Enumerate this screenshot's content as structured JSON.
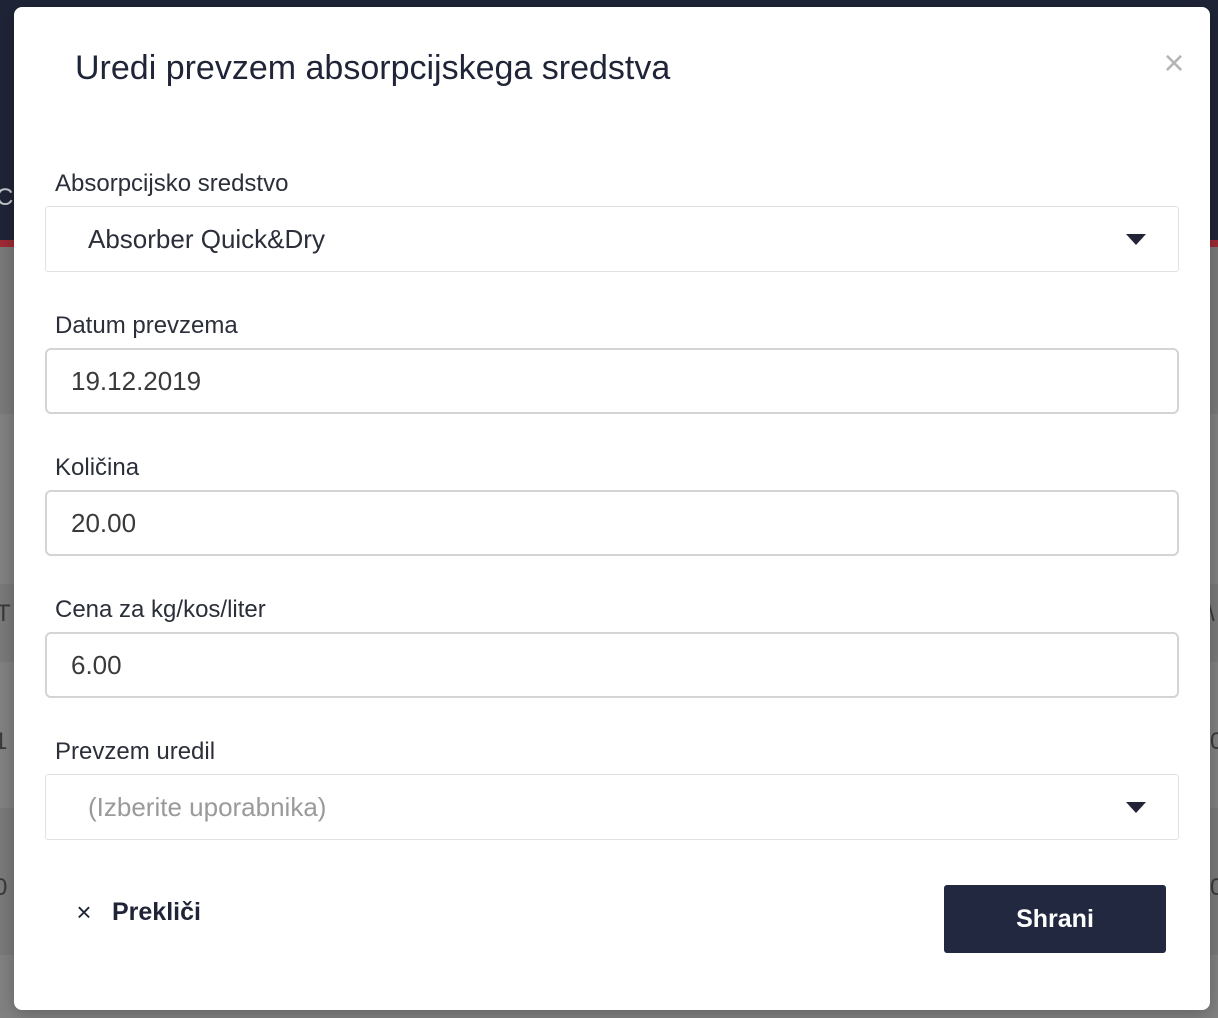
{
  "modal": {
    "title": "Uredi prevzem absorpcijskega sredstva",
    "close_symbol": "×"
  },
  "fields": {
    "absorbent": {
      "label": "Absorpcijsko sredstvo",
      "selected": "Absorber Quick&Dry",
      "icon": "caret-down-icon"
    },
    "date": {
      "label": "Datum prevzema",
      "value": "19.12.2019"
    },
    "quantity": {
      "label": "Količina",
      "value": "20.00"
    },
    "price": {
      "label": "Cena za kg/kos/liter",
      "value": "6.00"
    },
    "edited_by": {
      "label": "Prevzem uredil",
      "placeholder": "(Izberite uporabnika)",
      "icon": "caret-down-icon"
    }
  },
  "actions": {
    "cancel_symbol": "×",
    "cancel_label": "Prekliči",
    "save_label": "Shrani"
  },
  "background": {
    "fragments": [
      "C",
      "T",
      "1",
      "0",
      "\\",
      "0",
      "0"
    ]
  },
  "colors": {
    "primary": "#222840",
    "header_accent": "#9e2a34"
  }
}
